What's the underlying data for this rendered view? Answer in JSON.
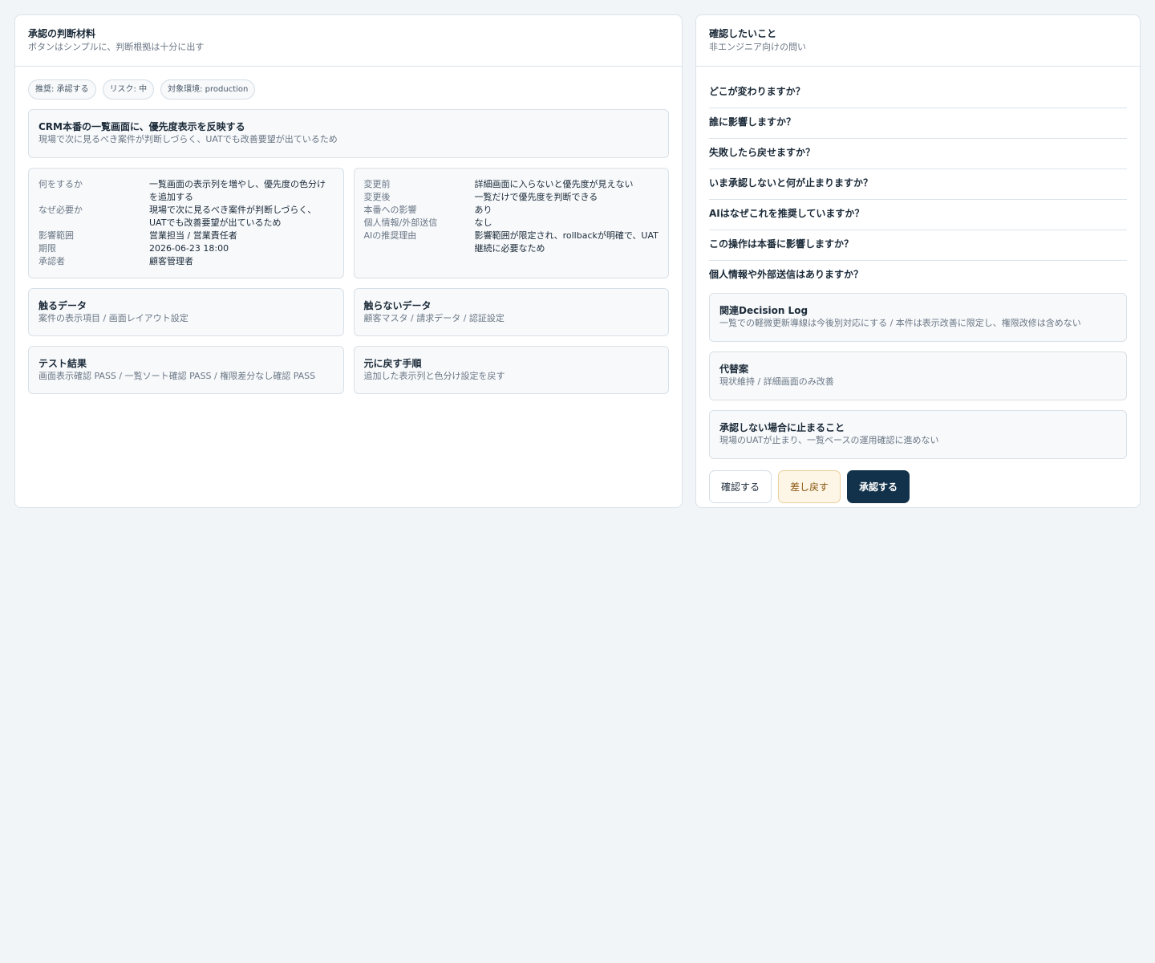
{
  "left": {
    "title": "承認の判断材料",
    "subtitle": "ボタンはシンプルに、判断根拠は十分に出す",
    "chips": [
      "推奨: 承認する",
      "リスク: 中",
      "対象環境: production"
    ],
    "summary": {
      "title": "CRM本番の一覧画面に、優先度表示を反映する",
      "text": "現場で次に見るべき案件が判断しづらく、UATでも改善要望が出ているため"
    },
    "details_a": [
      {
        "key": "何をするか",
        "value": "一覧画面の表示列を増やし、優先度の色分けを追加する"
      },
      {
        "key": "なぜ必要か",
        "value": "現場で次に見るべき案件が判断しづらく、UATでも改善要望が出ているため"
      },
      {
        "key": "影響範囲",
        "value": "営業担当 / 営業責任者"
      },
      {
        "key": "期限",
        "value": "2026-06-23 18:00"
      },
      {
        "key": "承認者",
        "value": "顧客管理者"
      }
    ],
    "details_b": [
      {
        "key": "変更前",
        "value": "詳細画面に入らないと優先度が見えない"
      },
      {
        "key": "変更後",
        "value": "一覧だけで優先度を判断できる"
      },
      {
        "key": "本番への影響",
        "value": "あり"
      },
      {
        "key": "個人情報/外部送信",
        "value": "なし"
      },
      {
        "key": "AIの推奨理由",
        "value": "影響範囲が限定され、rollbackが明確で、UAT継続に必要なため"
      }
    ],
    "touch_data": {
      "title": "触るデータ",
      "text": "案件の表示項目 / 画面レイアウト設定"
    },
    "untouched_data": {
      "title": "触らないデータ",
      "text": "顧客マスタ / 請求データ / 認証設定"
    },
    "test_results": {
      "title": "テスト結果",
      "text": "画面表示確認 PASS / 一覧ソート確認 PASS / 権限差分なし確認 PASS"
    },
    "rollback": {
      "title": "元に戻す手順",
      "text": "追加した表示列と色分け設定を戻す"
    }
  },
  "right": {
    "title": "確認したいこと",
    "subtitle": "非エンジニア向けの問い",
    "questions": [
      "どこが変わりますか？",
      "誰に影響しますか？",
      "失敗したら戻せますか？",
      "いま承認しないと何が止まりますか？",
      "AIはなぜこれを推奨していますか？",
      "この操作は本番に影響しますか？",
      "個人情報や外部送信はありますか？"
    ],
    "decision_log": {
      "title": "関連Decision Log",
      "text": "一覧での軽微更新導線は今後別対応にする / 本件は表示改善に限定し、権限改修は含めない"
    },
    "alternative": {
      "title": "代替案",
      "text": "現状維持 / 詳細画面のみ改善"
    },
    "blocked": {
      "title": "承認しない場合に止まること",
      "text": "現場のUATが止まり、一覧ベースの運用確認に進めない"
    },
    "buttons": {
      "confirm": "確認する",
      "send_back": "差し戻す",
      "approve": "承認する"
    }
  },
  "colors": {
    "approve_button": "#11324a",
    "send_back_button": "#fdf5e6",
    "background": "#f1f5f8"
  }
}
